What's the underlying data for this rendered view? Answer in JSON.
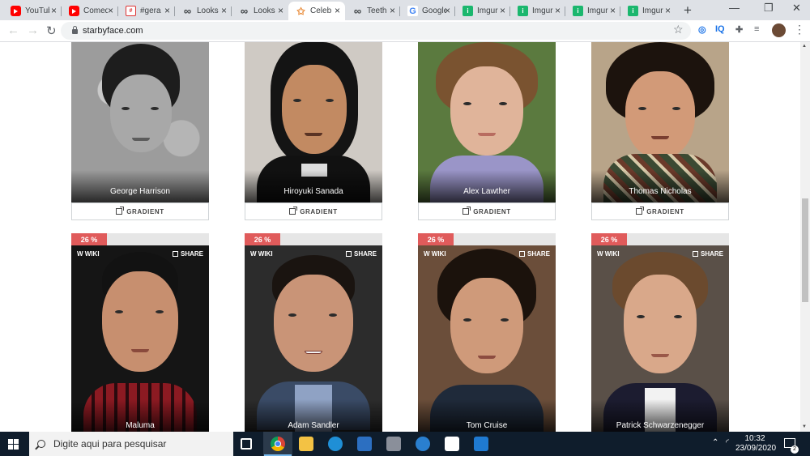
{
  "browser": {
    "tabs": [
      {
        "title": "YouTube",
        "icon": "youtube-icon"
      },
      {
        "title": "Comedy",
        "icon": "youtube-icon"
      },
      {
        "title": "#gera",
        "icon": "hashtag-site-icon"
      },
      {
        "title": "Looks",
        "icon": "infinity-icon"
      },
      {
        "title": "Looks",
        "icon": "infinity-icon"
      },
      {
        "title": "Celeb",
        "icon": "star-icon"
      },
      {
        "title": "Teeth",
        "icon": "infinity-icon"
      },
      {
        "title": "Google",
        "icon": "google-icon"
      },
      {
        "title": "Imgur",
        "icon": "imgur-icon"
      },
      {
        "title": "Imgur",
        "icon": "imgur-icon"
      },
      {
        "title": "Imgur",
        "icon": "imgur-icon"
      },
      {
        "title": "Imgur",
        "icon": "imgur-icon"
      }
    ],
    "active_tab_index": 5,
    "url": "starbyface.com"
  },
  "page": {
    "top_row": [
      {
        "name": "George Harrison",
        "button_label": "GRADIENT"
      },
      {
        "name": "Hiroyuki Sanada",
        "button_label": "GRADIENT"
      },
      {
        "name": "Alex Lawther",
        "button_label": "GRADIENT"
      },
      {
        "name": "Thomas Nicholas",
        "button_label": "GRADIENT"
      }
    ],
    "bottom_row": [
      {
        "name": "Maluma",
        "percent": "26 %",
        "wiki_label": "WIKI",
        "share_label": "SHARE"
      },
      {
        "name": "Adam Sandler",
        "percent": "26 %",
        "wiki_label": "WIKI",
        "share_label": "SHARE"
      },
      {
        "name": "Tom Cruise",
        "percent": "26 %",
        "wiki_label": "WIKI",
        "share_label": "SHARE"
      },
      {
        "name": "Patrick Schwarzenegger",
        "percent": "26 %",
        "wiki_label": "WIKI",
        "share_label": "SHARE"
      }
    ],
    "colors": {
      "percent_badge": "#e05b5b",
      "page_background": "#ffffff"
    }
  },
  "taskbar": {
    "search_placeholder": "Digite aqui para pesquisar",
    "time": "10:32",
    "date": "23/09/2020",
    "notification_count": "2"
  }
}
